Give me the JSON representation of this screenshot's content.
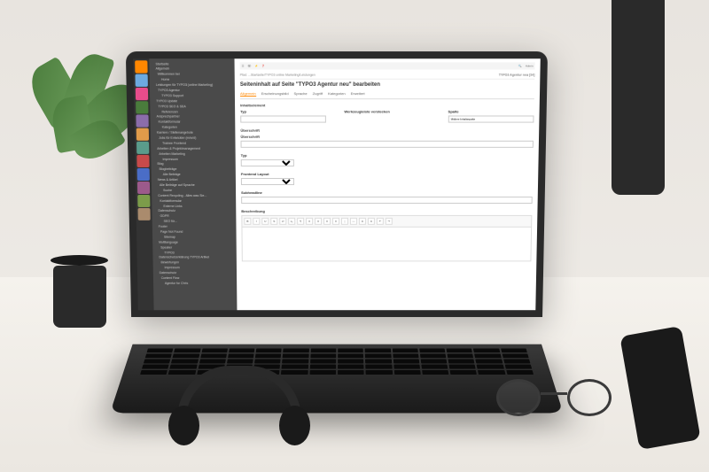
{
  "app": {
    "name": "TYPO3"
  },
  "topbar": {
    "search": "Suchen",
    "user": "Admin"
  },
  "modules": [
    {
      "name": "web",
      "color": "#ff8700"
    },
    {
      "name": "page",
      "color": "#6daae0"
    },
    {
      "name": "view",
      "color": "#e74c8b"
    },
    {
      "name": "list",
      "color": "#4a7c3c"
    },
    {
      "name": "info",
      "color": "#8b6daa"
    },
    {
      "name": "workspaces",
      "color": "#e09b4a"
    },
    {
      "name": "template",
      "color": "#5a9c8b"
    },
    {
      "name": "filelist",
      "color": "#c74a4a"
    },
    {
      "name": "admin",
      "color": "#4a6dc7"
    },
    {
      "name": "tools",
      "color": "#9c5a8b"
    },
    {
      "name": "system",
      "color": "#7c9c4a"
    },
    {
      "name": "help",
      "color": "#aa8b6d"
    }
  ],
  "tree": {
    "root": "Startseite",
    "items": [
      "Allgemein",
      "Willkommen bei",
      "Home",
      "Leistungen für TYPO3 (online Marketing)",
      "TYPO3 Agentur",
      "TYPO3 Support",
      "TYPO3 Update",
      "TYPO3 SEO & SEA",
      "Referenzen",
      "Ansprechpartner",
      "Kontaktformular",
      "Kategorien",
      "Karriere / Stellenangebote",
      "Jobs für Entwickler (m/w/d)",
      "Trainee Frontend",
      "Arbeiten & Projektmanagement",
      "Arbeiten Marketing",
      "Impressum",
      "Blog",
      "Blogbeiträge",
      "Alle Beiträge",
      "News & Artikel",
      "Alle Beiträge auf Sprache",
      "Suche",
      "Content Recycling - Alles was Sie...",
      "Kontaktformular",
      "Externe Links",
      "Datenschutz",
      "GDPR",
      "SEO für...",
      "Footer",
      "Page Not Found",
      "Sitemap",
      "Multilanguage",
      "Speaker",
      "TYPO3",
      "Datenschutzerklärung TYPO3 Artikel",
      "Bewertungen",
      "Impressum",
      "Datenschutz",
      "Content Flow",
      "Agentur for Chris"
    ]
  },
  "breadcrumb": {
    "path": "Pfad: ...Startseite/TYPO3 online Marketing/Leistungen",
    "context": "TYPO3 Agentur neu [34]"
  },
  "page": {
    "title": "Seiteninhalt auf Seite \"TYPO3 Agentur neu\" bearbeiten"
  },
  "tabs": [
    {
      "label": "Allgemein",
      "active": true
    },
    {
      "label": "Erscheinungsbild",
      "active": false
    },
    {
      "label": "Sprache",
      "active": false
    },
    {
      "label": "Zugriff",
      "active": false
    },
    {
      "label": "Kategorien",
      "active": false
    },
    {
      "label": "Erweitert",
      "active": false
    }
  ],
  "form": {
    "section1": "Inhaltselement",
    "type_label": "Typ",
    "type_value": "",
    "visibility_label": "Werkzeugleiste verstecken",
    "column_label": "Spalte",
    "column_value": "Mittlere Inhaltsspalte",
    "header_section": "Überschrift",
    "header_label": "Überschrift",
    "header_value": "",
    "header_type_label": "Typ",
    "header_type_value": "",
    "layout_label": "Frontend Layout",
    "layout_value": "",
    "subheader_label": "Subheadline",
    "subheader_value": "",
    "desc_label": "Beschreibung",
    "rte_buttons": [
      "B",
      "I",
      "U",
      "S",
      "x²",
      "x₂",
      "¶",
      "≡",
      "≡",
      "≡",
      "≡",
      "⋮",
      "—",
      "A",
      "A",
      "↶",
      "↷"
    ]
  }
}
